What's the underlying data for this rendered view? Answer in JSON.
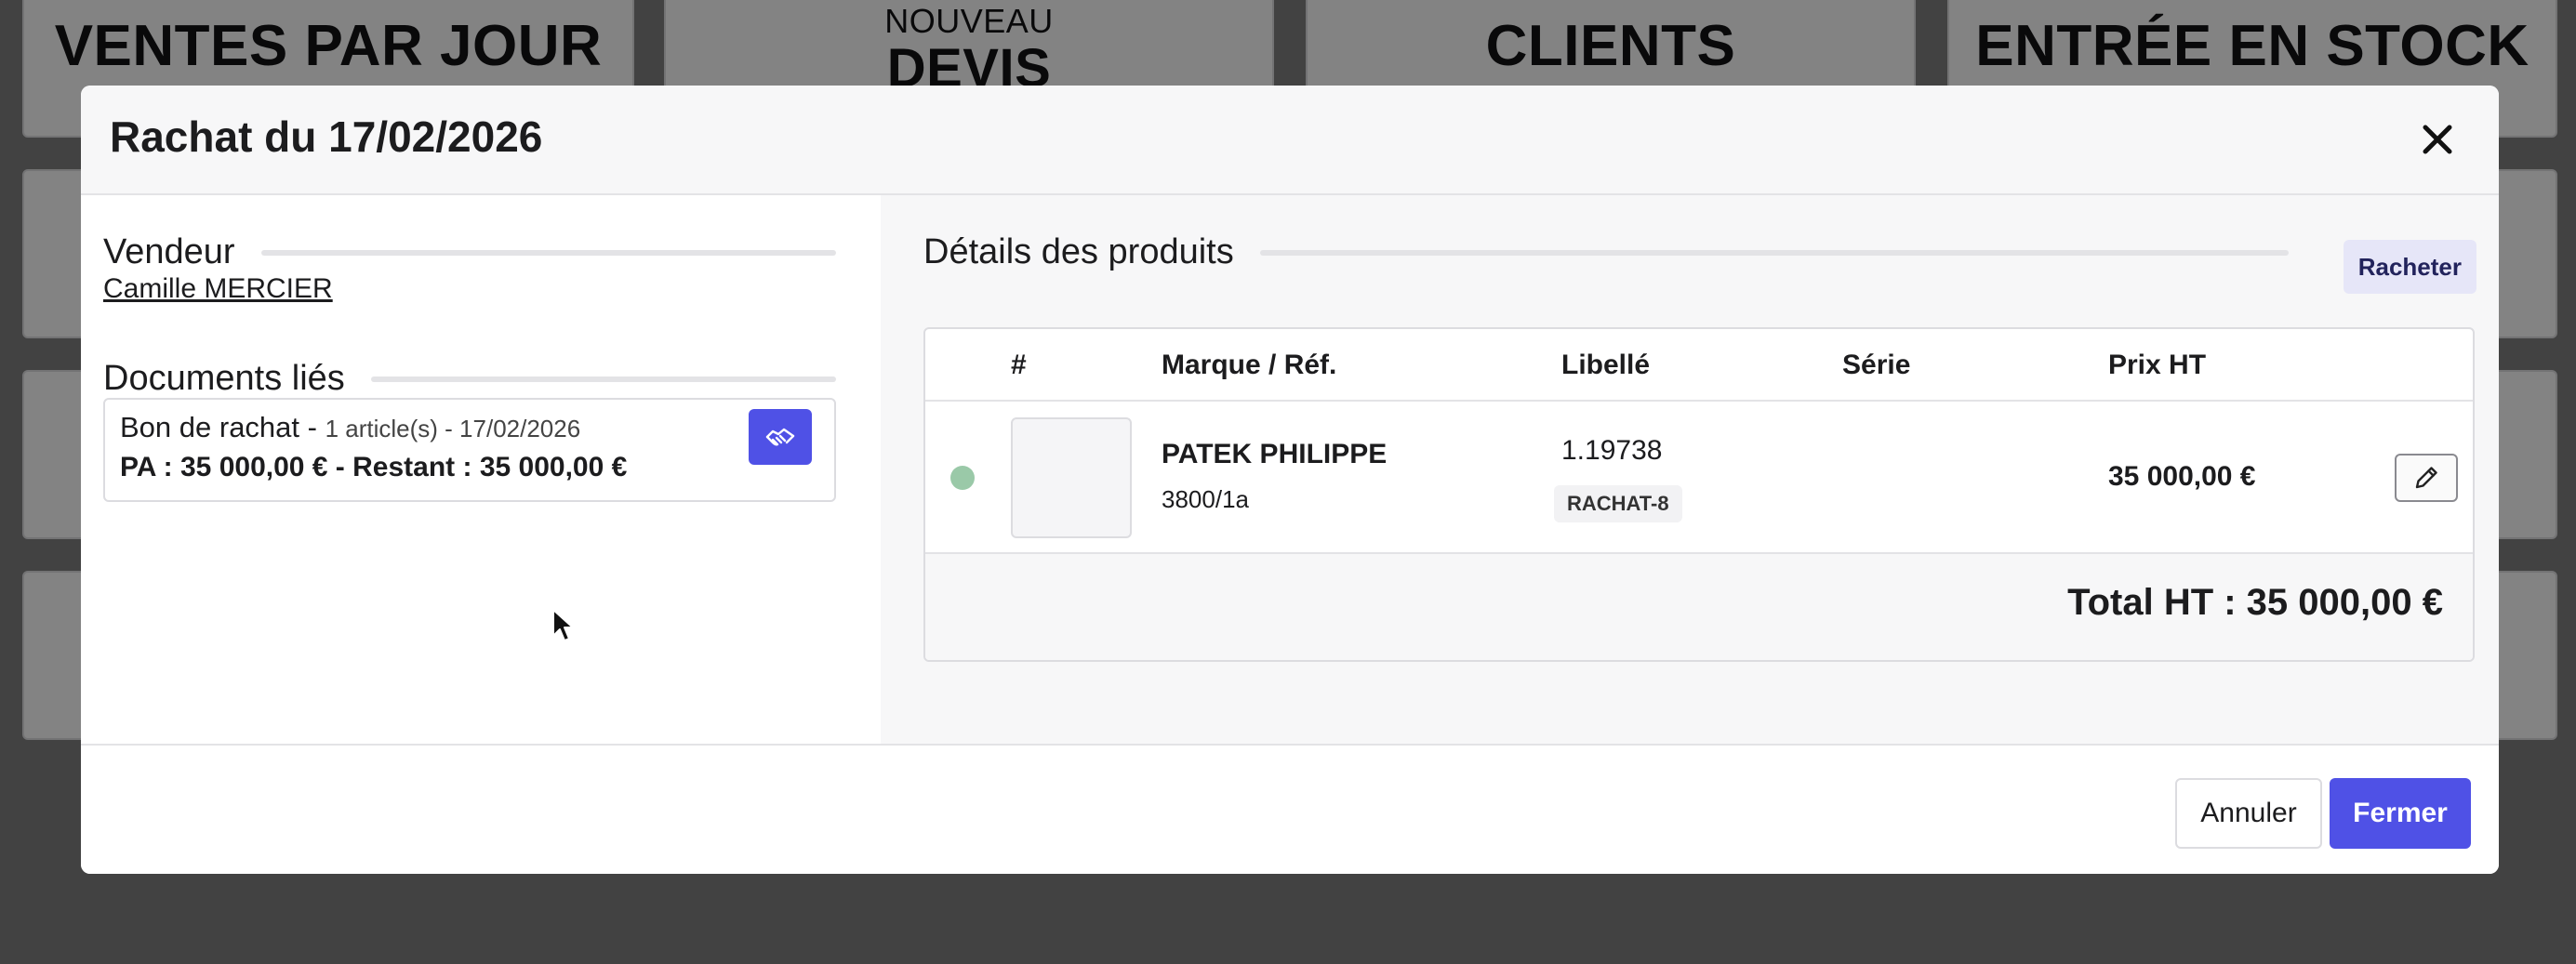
{
  "background": {
    "tiles": [
      {
        "title": "VENTES PAR JOUR"
      },
      {
        "subtitle": "NOUVEAU",
        "title": "DEVIS"
      },
      {
        "title": "CLIENTS"
      },
      {
        "title": "ENTRÉE EN STOCK"
      }
    ]
  },
  "modal": {
    "title": "Rachat du 17/02/2026",
    "seller_section": "Vendeur",
    "seller_name": "Camille MERCIER",
    "docs_section": "Documents liés",
    "doc": {
      "name": "Bon de rachat -",
      "meta": "1 article(s) - 17/02/2026",
      "amounts": "PA : 35 000,00 € - Restant : 35 000,00 €"
    },
    "products_section": "Détails des produits",
    "racheter_label": "Racheter",
    "table": {
      "headers": [
        "#",
        "Marque / Réf.",
        "Libellé",
        "Série",
        "Prix HT"
      ],
      "rows": [
        {
          "status_color": "#9ac9a8",
          "brand": "PATEK PHILIPPE",
          "ref": "3800/1a",
          "label": "1.19738",
          "tag": "RACHAT-8",
          "serial": "",
          "price": "35 000,00 €"
        }
      ],
      "total": "Total HT : 35 000,00 €"
    },
    "cancel_label": "Annuler",
    "close_label": "Fermer"
  },
  "colors": {
    "accent": "#4f51e6",
    "status_green": "#9ac9a8"
  },
  "icons": {
    "close": "close-icon",
    "handshake": "handshake-icon",
    "edit": "pencil-icon"
  }
}
